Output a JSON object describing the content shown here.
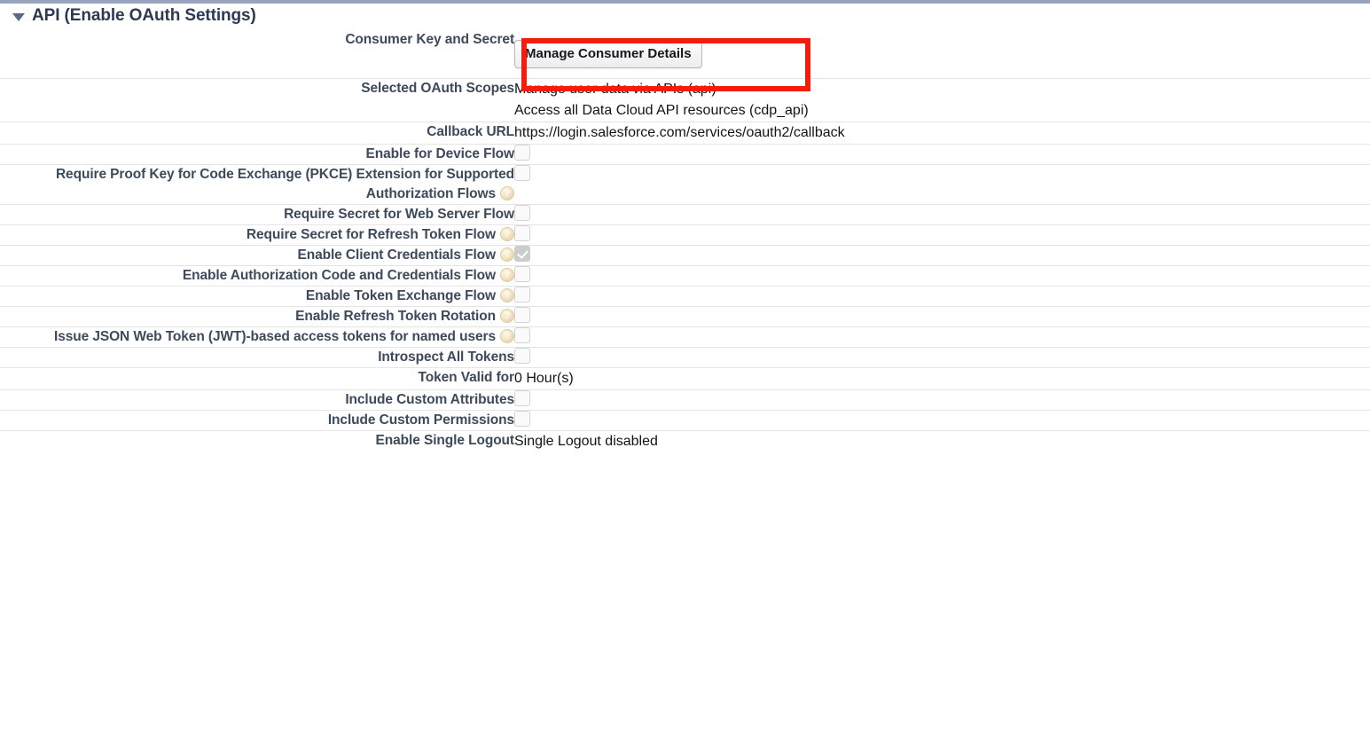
{
  "section": {
    "title": "API (Enable OAuth Settings)",
    "expanded_icon": "triangle-down-icon"
  },
  "rows": [
    {
      "label": "Consumer Key and Secret",
      "help": false,
      "type": "button",
      "button_label": "Manage Consumer Details",
      "highlighted": true
    },
    {
      "label": "Selected OAuth Scopes",
      "help": false,
      "type": "text-multiline",
      "values": [
        "Manage user data via APIs (api)",
        "Access all Data Cloud API resources (cdp_api)"
      ]
    },
    {
      "label": "Callback URL",
      "help": false,
      "type": "text",
      "value": "https://login.salesforce.com/services/oauth2/callback"
    },
    {
      "label": "Enable for Device Flow",
      "help": false,
      "type": "checkbox",
      "checked": false
    },
    {
      "label": "Require Proof Key for Code Exchange (PKCE) Extension for Supported Authorization Flows",
      "help": true,
      "type": "checkbox",
      "checked": false
    },
    {
      "label": "Require Secret for Web Server Flow",
      "help": false,
      "type": "checkbox",
      "checked": false
    },
    {
      "label": "Require Secret for Refresh Token Flow",
      "help": true,
      "type": "checkbox",
      "checked": false
    },
    {
      "label": "Enable Client Credentials Flow",
      "help": true,
      "type": "checkbox",
      "checked": true
    },
    {
      "label": "Enable Authorization Code and Credentials Flow",
      "help": true,
      "type": "checkbox",
      "checked": false
    },
    {
      "label": "Enable Token Exchange Flow",
      "help": true,
      "type": "checkbox",
      "checked": false
    },
    {
      "label": "Enable Refresh Token Rotation",
      "help": true,
      "type": "checkbox",
      "checked": false
    },
    {
      "label": "Issue JSON Web Token (JWT)-based access tokens for named users",
      "help": true,
      "type": "checkbox",
      "checked": false
    },
    {
      "label": "Introspect All Tokens",
      "help": false,
      "type": "checkbox",
      "checked": false
    },
    {
      "label": "Token Valid for",
      "help": false,
      "type": "text",
      "value": "0 Hour(s)"
    },
    {
      "label": "Include Custom Attributes",
      "help": false,
      "type": "checkbox",
      "checked": false
    },
    {
      "label": "Include Custom Permissions",
      "help": false,
      "type": "checkbox",
      "checked": false
    },
    {
      "label": "Enable Single Logout",
      "help": false,
      "type": "text",
      "value": "Single Logout disabled"
    }
  ],
  "colors": {
    "top_rule": "#99a3bf",
    "label_text": "#3d4a5c",
    "value_text": "#111418",
    "row_divider": "#e4e4e4",
    "highlight_border": "#f41c0d",
    "checkbox_checked_fill": "#cccccc",
    "help_icon": "#eadfc0"
  }
}
